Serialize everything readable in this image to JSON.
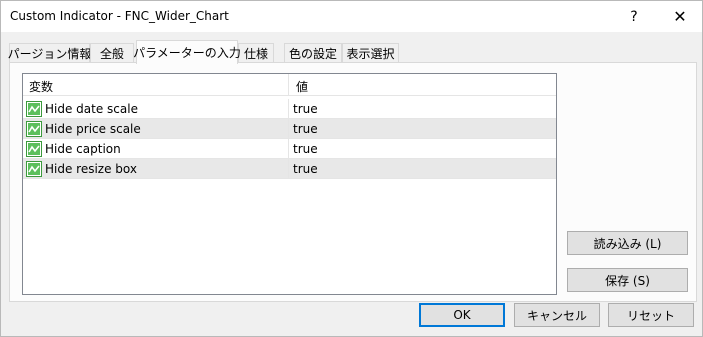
{
  "window": {
    "title": "Custom Indicator - FNC_Wider_Chart",
    "help_label": "?",
    "close_label": "✕"
  },
  "tabs": [
    {
      "label": "パージョン情報"
    },
    {
      "label": "全般"
    },
    {
      "label": "パラメーターの入力"
    },
    {
      "label": "仕様"
    },
    {
      "label": "色の設定"
    },
    {
      "label": "表示選択"
    }
  ],
  "active_tab": "パラメーターの入力",
  "table": {
    "headers": {
      "variable": "変数",
      "value": "値"
    },
    "rows": [
      {
        "name": "Hide date scale",
        "value": "true",
        "icon": "parameter-icon"
      },
      {
        "name": "Hide price scale",
        "value": "true",
        "icon": "parameter-icon"
      },
      {
        "name": "Hide caption",
        "value": "true",
        "icon": "parameter-icon"
      },
      {
        "name": "Hide resize box",
        "value": "true",
        "icon": "parameter-icon"
      }
    ]
  },
  "side_buttons": {
    "load": "読み込み (L)",
    "save": "保存 (S)"
  },
  "dialog_buttons": {
    "ok": "OK",
    "cancel": "キャンセル",
    "reset": "リセット"
  },
  "colors": {
    "selected_row": "#e8e8e8",
    "default_button_border": "#0078d7",
    "icon_green": "#3c9a3c"
  }
}
